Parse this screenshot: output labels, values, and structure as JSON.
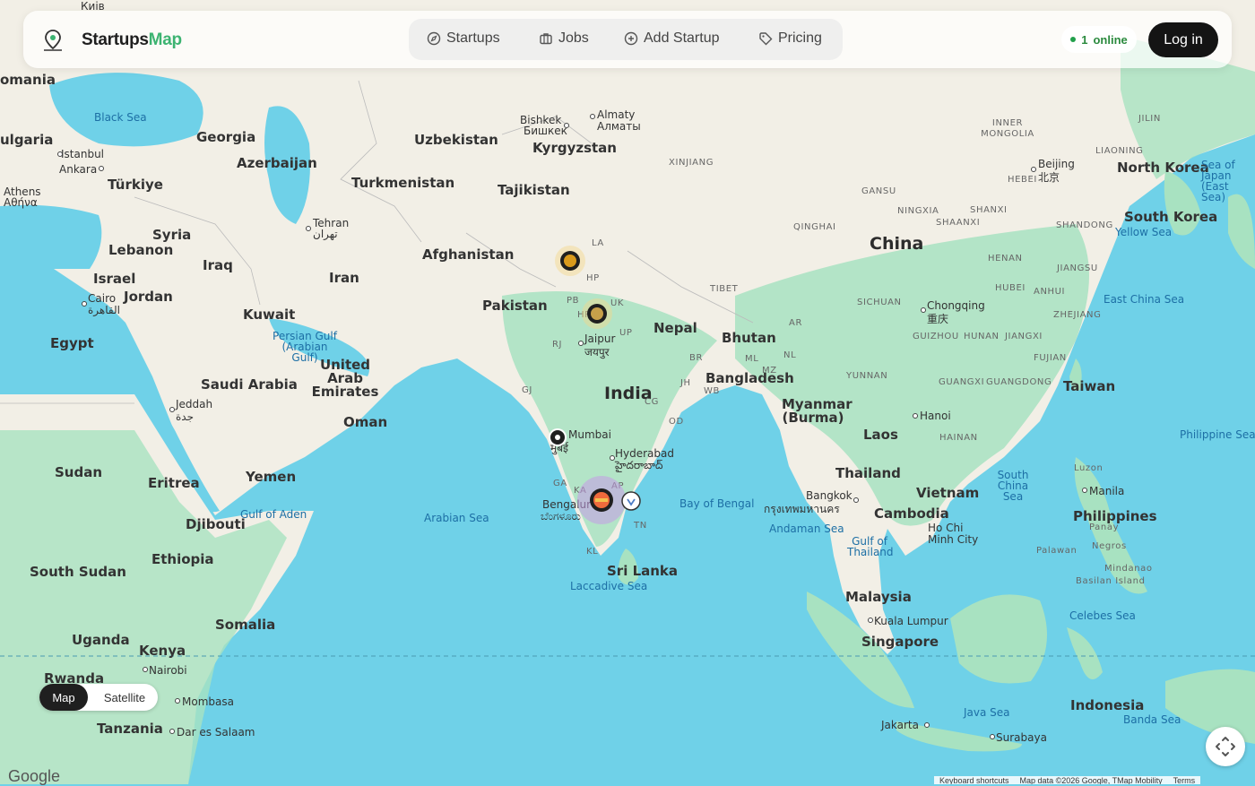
{
  "header": {
    "brand_main": "Startups",
    "brand_accent": "Map",
    "nav": [
      {
        "label": "Startups",
        "icon": "compass-icon"
      },
      {
        "label": "Jobs",
        "icon": "briefcase-icon"
      },
      {
        "label": "Add Startup",
        "icon": "plus-circle-icon"
      },
      {
        "label": "Pricing",
        "icon": "tag-icon"
      }
    ],
    "online_count": "1",
    "online_label": "online",
    "login_label": "Log in"
  },
  "map_type": {
    "map_label": "Map",
    "satellite_label": "Satellite",
    "selected": "Map"
  },
  "google_logo": "Google",
  "attribution": {
    "keyboard": "Keyboard shortcuts",
    "data": "Map data ©2026 Google, TMap Mobility",
    "terms": "Terms"
  },
  "labels": {
    "countries": [
      "Georgia",
      "Azerbaijan",
      "Türkiye",
      "Turkmenistan",
      "Uzbekistan",
      "Kyrgyzstan",
      "Tajikistan",
      "Afghanistan",
      "Pakistan",
      "Iran",
      "Iraq",
      "Syria",
      "Lebanon",
      "Israel",
      "Jordan",
      "Kuwait",
      "Egypt",
      "Saudi Arabia",
      "United Arab Emirates",
      "Oman",
      "Yemen",
      "Sudan",
      "Eritrea",
      "Djibouti",
      "Ethiopia",
      "South Sudan",
      "Somalia",
      "Uganda",
      "Kenya",
      "Rwanda",
      "Tanzania",
      "India",
      "Nepal",
      "Bhutan",
      "Bangladesh",
      "Myanmar (Burma)",
      "Laos",
      "Thailand",
      "Vietnam",
      "Cambodia",
      "Malaysia",
      "Singapore",
      "Indonesia",
      "Philippines",
      "Taiwan",
      "North Korea",
      "South Korea",
      "China",
      "Sri Lanka",
      "omania",
      "ulgaria"
    ],
    "seas": [
      "Black Sea",
      "Persian Gulf (Arabian Gulf)",
      "Gulf of Aden",
      "Arabian Sea",
      "Laccadive Sea",
      "Bay of Bengal",
      "Andaman Sea",
      "Gulf of Thailand",
      "South China Sea",
      "Philippine Sea",
      "East China Sea",
      "Yellow Sea",
      "Sea of Japan (East Sea)",
      "Java Sea",
      "Banda Sea",
      "Celebes Sea"
    ],
    "cities": [
      "Istanbul",
      "Ankara",
      "Athens",
      "Αθήνα",
      "Tehran",
      "تهران",
      "Cairo",
      "القاهرة",
      "Jeddah",
      "جدة",
      "Bishkek",
      "Бишкек",
      "Almaty",
      "Алматы",
      "Jaipur",
      "जयपुर",
      "Mumbai",
      "मुंबई",
      "Hyderabad",
      "హైదరాబాద్",
      "Bengaluru",
      "ಬೆಂಗಳೂರು",
      "Chongqing",
      "重庆",
      "Beijing",
      "北京",
      "Hanoi",
      "Bangkok",
      "กรุงเทพมหานคร",
      "Ho Chi Minh City",
      "Manila",
      "Kuala Lumpur",
      "Jakarta",
      "Surabaya",
      "Nairobi",
      "Mombasa",
      "Dar es Salaam",
      "Киів"
    ],
    "regions": [
      "XINJIANG",
      "GANSU",
      "QINGHAI",
      "TIBET",
      "SICHUAN",
      "YUNNAN",
      "GUIZHOU",
      "HUNAN",
      "JIANGXI",
      "FUJIAN",
      "GUANGXI",
      "GUANGDONG",
      "HENAN",
      "HUBEI",
      "ANHUI",
      "ZHEJIANG",
      "JIANGSU",
      "SHANDONG",
      "SHANXI",
      "SHAANXI",
      "NINGXIA",
      "HEBEI",
      "INNER MONGOLIA",
      "JILIN",
      "LIAONING",
      "HAINAN",
      "Luzon",
      "Panay",
      "Negros",
      "Palawan",
      "Mindanao",
      "Basilan Island",
      "LA",
      "HP",
      "PB",
      "UK",
      "RJ",
      "UP",
      "GJ",
      "BR",
      "JH",
      "WB",
      "OD",
      "CG",
      "KA",
      "AP",
      "TN",
      "KL",
      "GA",
      "ML",
      "AR",
      "NL",
      "MZ",
      "HR"
    ]
  },
  "markers": [
    {
      "name": "marker-kashmir",
      "type": "gold"
    },
    {
      "name": "marker-delhi",
      "type": "gold"
    },
    {
      "name": "marker-mumbai",
      "type": "black"
    },
    {
      "name": "marker-bengaluru",
      "type": "purple-cluster"
    },
    {
      "name": "marker-chennai",
      "type": "outline"
    }
  ],
  "colors": {
    "water": "#6fd1e8",
    "land": "#f2efe6",
    "green": "#9bdcb8",
    "brand_accent": "#3cb371",
    "login_bg": "#141414"
  }
}
